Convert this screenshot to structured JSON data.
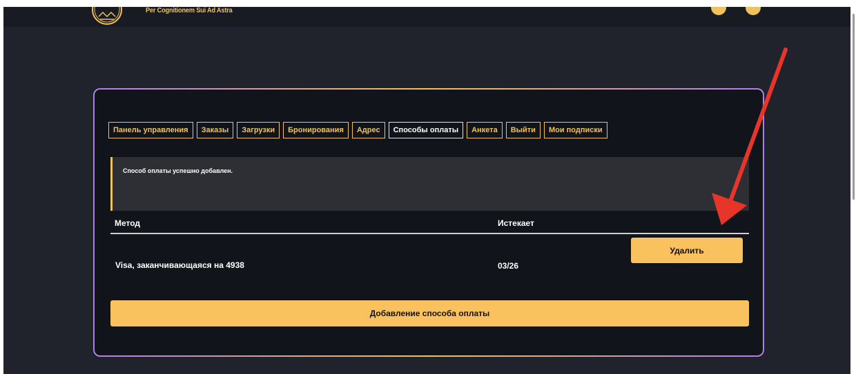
{
  "header": {
    "tagline": "Per Cognitionem Sui Ad Astra",
    "logo_icon": "emblem-logo-icon"
  },
  "account_nav": {
    "tabs": [
      {
        "label": "Панель управления",
        "active": false
      },
      {
        "label": "Заказы",
        "active": false
      },
      {
        "label": "Загрузки",
        "active": false
      },
      {
        "label": "Бронирования",
        "active": false
      },
      {
        "label": "Адрес",
        "active": false
      },
      {
        "label": "Способы оплаты",
        "active": true
      },
      {
        "label": "Анкета",
        "active": false
      },
      {
        "label": "Выйти",
        "active": false
      },
      {
        "label": "Мои подписки",
        "active": false
      }
    ]
  },
  "notice": {
    "message": "Способ оплаты успешно добавлен."
  },
  "payment_methods": {
    "columns": [
      "Метод",
      "Истекает"
    ],
    "rows": [
      {
        "method": "Visa, заканчивающаяся на 4938",
        "expires": "03/26",
        "action_label": "Удалить"
      }
    ]
  },
  "add_button_label": "Добавление способа оплаты",
  "colors": {
    "accent": "#f9c25f",
    "page_background": "#20232c",
    "card_background": "#11141b",
    "card_border_secondary": "#b080e6",
    "annotation_arrow": "#e8352a"
  }
}
